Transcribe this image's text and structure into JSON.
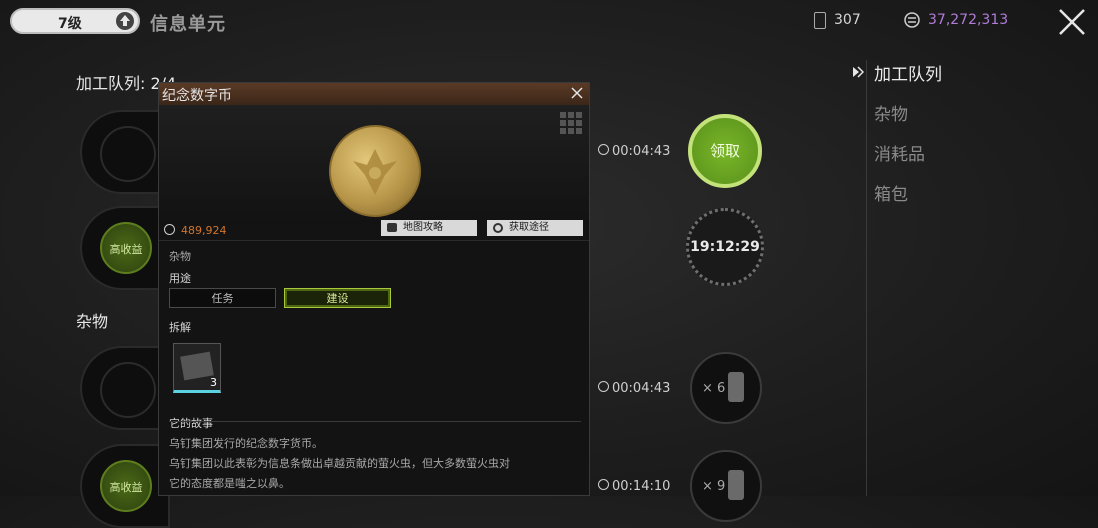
{
  "topbar": {
    "level": "7级",
    "title": "信息单元",
    "battery_count": "307",
    "currency": "37,272,313",
    "currency_color": "#b07cd8"
  },
  "queue": {
    "label": "加工队列: 2/4",
    "income_label": "高收益"
  },
  "misc": {
    "label": "杂物",
    "income_label": "高收益"
  },
  "timers": {
    "t1": "00:04:43",
    "t2": "00:04:43",
    "t3": "00:14:10",
    "countdown": "19:12:29",
    "claim_label": "领取",
    "qty1": "× 6",
    "qty2": "× 9"
  },
  "categories": [
    {
      "label": "加工队列",
      "active": true
    },
    {
      "label": "杂物",
      "active": false
    },
    {
      "label": "消耗品",
      "active": false
    },
    {
      "label": "箱包",
      "active": false
    }
  ],
  "popup": {
    "title": "纪念数字币",
    "price": "489,924",
    "price_color": "#d0742e",
    "btn_map": "地图攻略",
    "btn_obtain": "获取途径",
    "category": "杂物",
    "usage_label": "用途",
    "usage_task": "任务",
    "usage_build": "建设",
    "dismantle_label": "拆解",
    "part_count": "3",
    "story_label": "它的故事",
    "story_line1": "乌钉集团发行的纪念数字货币。",
    "story_line2": "乌钉集团以此表彰为信息条做出卓越贡献的萤火虫，但大多数萤火虫对",
    "story_line3": "它的态度都是嗤之以鼻。"
  }
}
